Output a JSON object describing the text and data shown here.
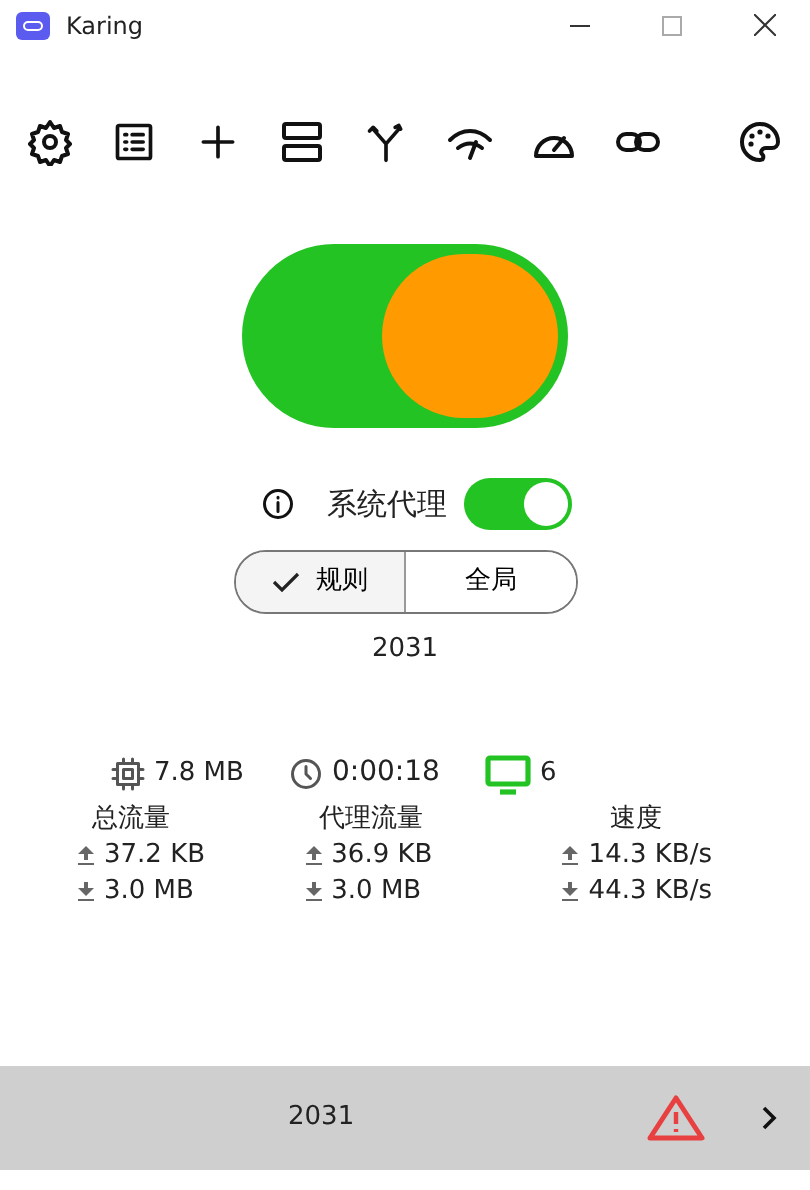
{
  "window": {
    "title": "Karing"
  },
  "main_switch": {
    "on": true
  },
  "system_proxy": {
    "label": "系统代理",
    "on": true
  },
  "modes": [
    {
      "label": "规则",
      "selected": true
    },
    {
      "label": "全局",
      "selected": false
    }
  ],
  "port": "2031",
  "stats": {
    "memory": "7.8 MB",
    "uptime": "0:00:18",
    "connections": "6"
  },
  "traffic": [
    {
      "title": "总流量",
      "upload": "37.2 KB",
      "download": "3.0 MB"
    },
    {
      "title": "代理流量",
      "upload": "36.9 KB",
      "download": "3.0 MB"
    },
    {
      "title": "速度",
      "upload": "14.3 KB/s",
      "download": "44.3 KB/s"
    }
  ],
  "footer": {
    "text": "2031"
  }
}
